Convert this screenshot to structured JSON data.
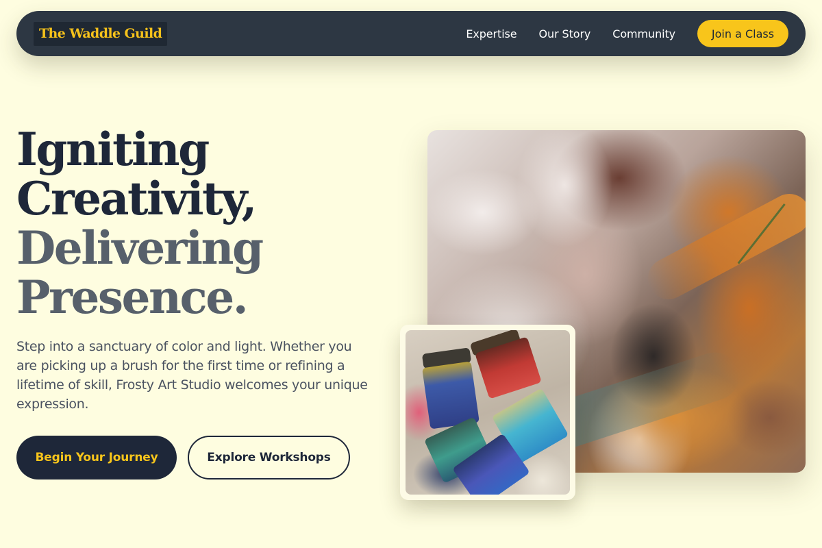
{
  "nav": {
    "brand": "The Waddle Guild",
    "links": [
      "Expertise",
      "Our Story",
      "Community"
    ],
    "cta": "Join a Class"
  },
  "hero": {
    "headline_line1": "Igniting",
    "headline_line2": "Creativity,",
    "headline_line3": "Delivering",
    "headline_line4": "Presence.",
    "lede": "Step into a sanctuary of color and light. Whether you are picking up a brush for the first time or refining a lifetime of skill, Frosty Art Studio welcomes your unique expression.",
    "primary_button": "Begin Your Journey",
    "secondary_button": "Explore Workshops"
  },
  "colors": {
    "background": "#fefde0",
    "nav_bg": "#2d3743",
    "accent": "#f8c51b",
    "heading_dark": "#1e2739",
    "heading_grey": "#57606b"
  }
}
